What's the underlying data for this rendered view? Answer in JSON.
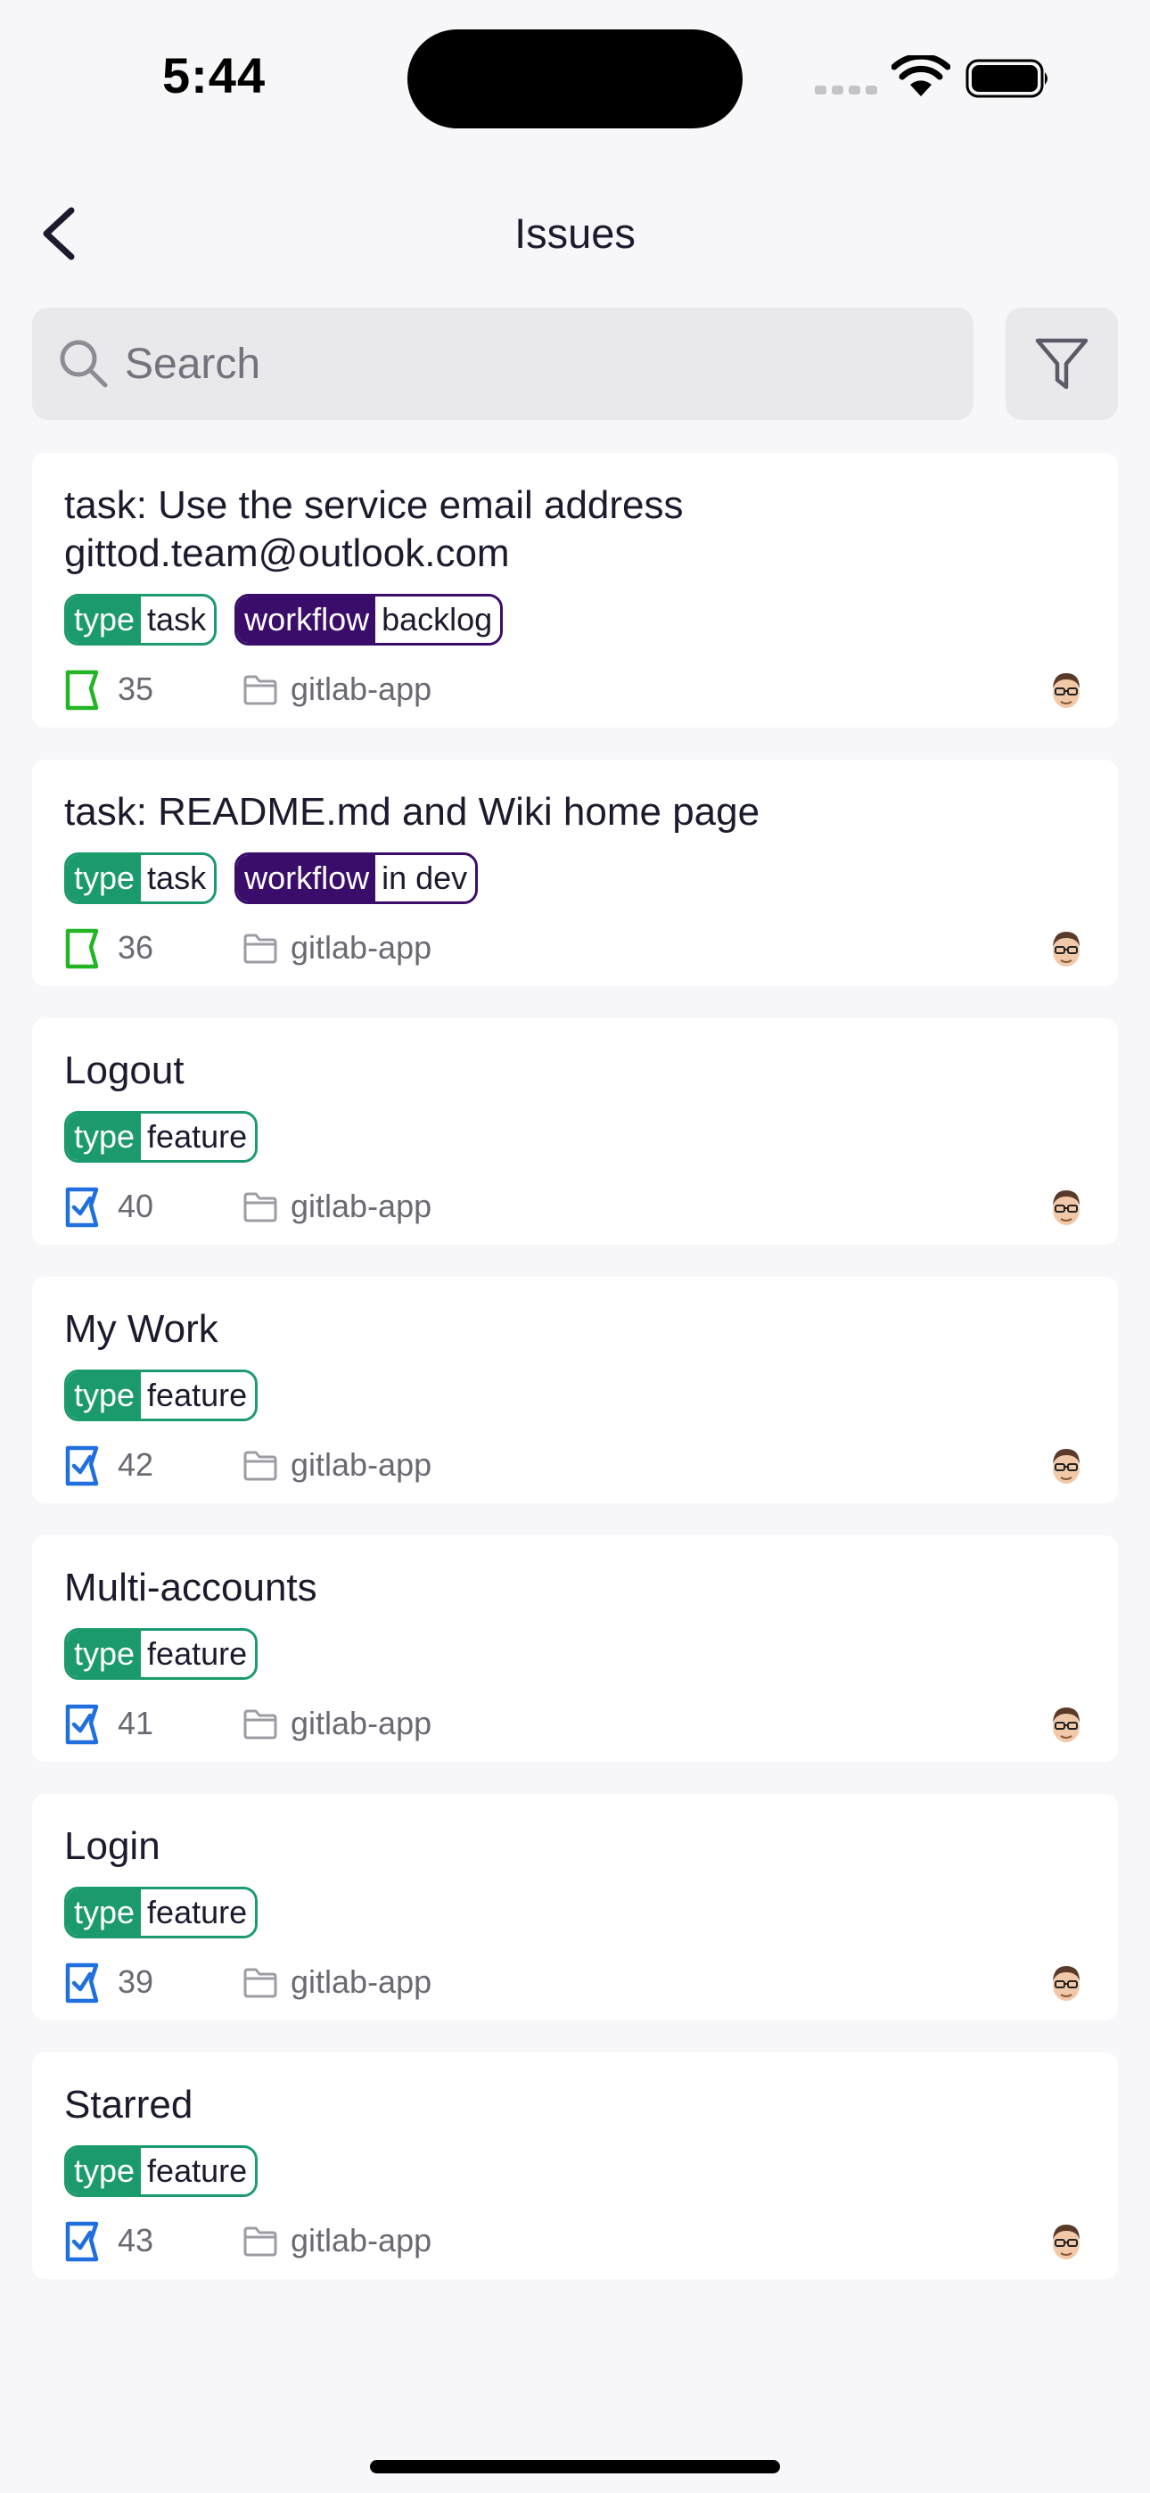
{
  "status_bar": {
    "time": "5:44"
  },
  "nav": {
    "title": "Issues"
  },
  "search": {
    "placeholder": "Search",
    "value": ""
  },
  "issues": [
    {
      "title": "task: Use the service email address gittod.team@outlook.com",
      "labels": [
        {
          "key": "type",
          "value": "task",
          "color": "#1b9b6c"
        },
        {
          "key": "workflow",
          "value": "backlog",
          "color": "#3a0d6b"
        }
      ],
      "type_icon": "task-icon",
      "number": "35",
      "project": "gitlab-app"
    },
    {
      "title": "task: README.md and Wiki home page",
      "labels": [
        {
          "key": "type",
          "value": "task",
          "color": "#1b9b6c"
        },
        {
          "key": "workflow",
          "value": "in dev",
          "color": "#3a0d6b"
        }
      ],
      "type_icon": "task-icon",
      "number": "36",
      "project": "gitlab-app"
    },
    {
      "title": "Logout",
      "labels": [
        {
          "key": "type",
          "value": "feature",
          "color": "#1b9b6c"
        }
      ],
      "type_icon": "issue-icon",
      "number": "40",
      "project": "gitlab-app"
    },
    {
      "title": "My Work",
      "labels": [
        {
          "key": "type",
          "value": "feature",
          "color": "#1b9b6c"
        }
      ],
      "type_icon": "issue-icon",
      "number": "42",
      "project": "gitlab-app"
    },
    {
      "title": "Multi-accounts",
      "labels": [
        {
          "key": "type",
          "value": "feature",
          "color": "#1b9b6c"
        }
      ],
      "type_icon": "issue-icon",
      "number": "41",
      "project": "gitlab-app"
    },
    {
      "title": "Login",
      "labels": [
        {
          "key": "type",
          "value": "feature",
          "color": "#1b9b6c"
        }
      ],
      "type_icon": "issue-icon",
      "number": "39",
      "project": "gitlab-app"
    },
    {
      "title": "Starred",
      "labels": [
        {
          "key": "type",
          "value": "feature",
          "color": "#1b9b6c"
        }
      ],
      "type_icon": "issue-icon",
      "number": "43",
      "project": "gitlab-app"
    }
  ],
  "colors": {
    "task_icon": "#23b523",
    "issue_icon": "#1f6fde",
    "background": "#f7f7f9"
  }
}
